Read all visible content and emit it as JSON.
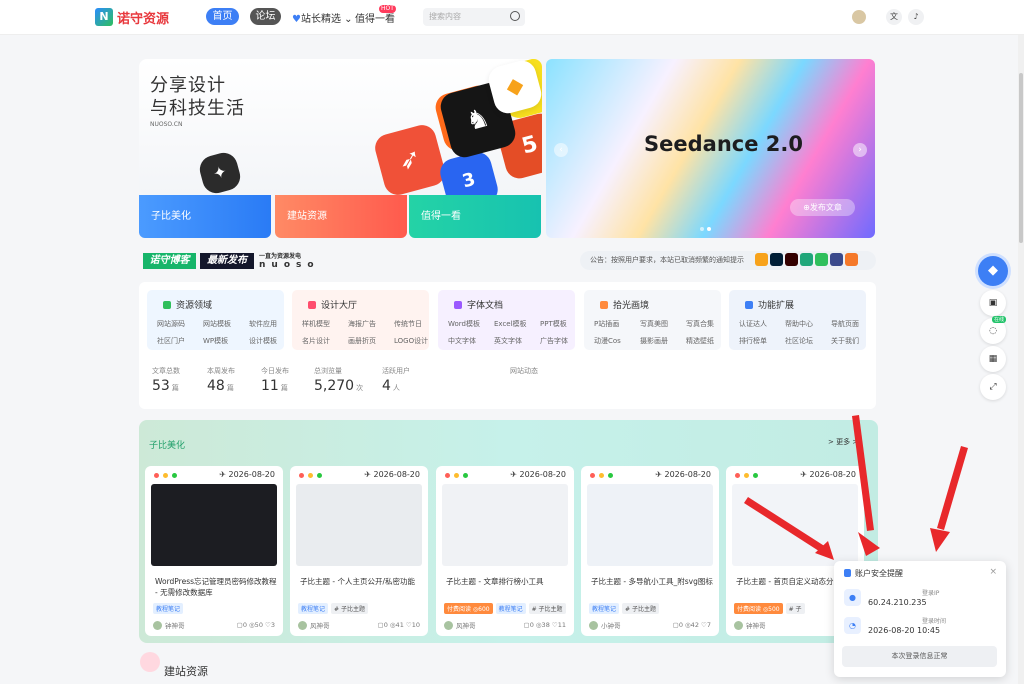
{
  "header": {
    "logo_text": "诺守资源",
    "nav": {
      "home": "首页",
      "forum": "论坛",
      "picks": "站长精选",
      "worth": "值得一看",
      "hot_badge": "HOT"
    },
    "search_placeholder": "搜索内容"
  },
  "hero": {
    "title_line1": "分享设计",
    "title_line2": "与科技生活",
    "site": "NUOSO.CN",
    "categories": [
      "子比美化",
      "建站资源",
      "值得一看"
    ],
    "slider": {
      "title": "Seedance 2.0",
      "publish_btn": "⊕发布文章"
    }
  },
  "strip": {
    "badge1": "诺守博客",
    "badge2": "最新发布",
    "slogan_top": "一直为资源发电",
    "slogan_brand": "nuoso",
    "notice": "公告：按照用户要求，本站已取消频繁的通知提示"
  },
  "directory": [
    {
      "name": "资源领域",
      "links": [
        "网站源码",
        "网站模板",
        "软件应用",
        "社区门户",
        "WP模板",
        "设计模板"
      ],
      "color": "#2fbf5c",
      "bg": "#eef6ff"
    },
    {
      "name": "设计大厅",
      "links": [
        "样机模型",
        "海报广告",
        "传统节日",
        "名片设计",
        "画册折页",
        "LOGO设计"
      ],
      "color": "#ff4d6d",
      "bg": "#fff3f0"
    },
    {
      "name": "字体文档",
      "links": [
        "Word模板",
        "Excel模板",
        "PPT模板",
        "中文字体",
        "英文字体",
        "广告字体"
      ],
      "color": "#9b59ff",
      "bg": "#f6f0ff"
    },
    {
      "name": "拾光画境",
      "links": [
        "P站插画",
        "写真美图",
        "写真合集",
        "动漫Cos",
        "摄影画册",
        "精选壁纸"
      ],
      "color": "#ff8a3d",
      "bg": "#f5f7fa"
    },
    {
      "name": "功能扩展",
      "links": [
        "认证达人",
        "帮助中心",
        "导航页面",
        "排行榜单",
        "社区论坛",
        "关于我们"
      ],
      "color": "#3d7ff5",
      "bg": "#eef3fb"
    }
  ],
  "stats": [
    {
      "label": "文章总数",
      "value": "53",
      "unit": "篇"
    },
    {
      "label": "本周发布",
      "value": "48",
      "unit": "篇"
    },
    {
      "label": "今日发布",
      "value": "11",
      "unit": "篇"
    },
    {
      "label": "总浏览量",
      "value": "5,270",
      "unit": "次"
    },
    {
      "label": "活跃用户",
      "value": "4",
      "unit": "人"
    }
  ],
  "site_activity_label": "网站动态",
  "section": {
    "title": "子比美化",
    "more": "> 更多 >",
    "cards": [
      {
        "date": "✈ 2026-08-20",
        "title": "WordPress忘记管理员密码修改教程 - 无需修改数据库",
        "tags": [
          "教程笔记"
        ],
        "paid": "",
        "author": "钟神哥",
        "meta": "▢0 ◎50 ♡3",
        "thumb": "#1c1d22"
      },
      {
        "date": "✈ 2026-08-20",
        "title": "子比主题 - 个人主页公开/私密功能",
        "tags": [
          "教程笔记",
          "# 子比主题"
        ],
        "paid": "",
        "author": "风神哥",
        "meta": "▢0 ◎41 ♡10",
        "thumb": "#e9ecef"
      },
      {
        "date": "✈ 2026-08-20",
        "title": "子比主题 - 文章排行榜小工具",
        "tags": [
          "教程笔记",
          "# 子比主题"
        ],
        "paid": "付费阅读 ◎600",
        "author": "风神哥",
        "meta": "▢0 ◎38 ♡11",
        "thumb": "#f0f2f5"
      },
      {
        "date": "✈ 2026-08-20",
        "title": "子比主题 - 多导航小工具_附svg图标",
        "tags": [
          "教程笔记",
          "# 子比主题"
        ],
        "paid": "",
        "author": "小钟哥",
        "meta": "▢0 ◎42 ♡7",
        "thumb": "#eef2f7"
      },
      {
        "date": "✈ 2026-08-20",
        "title": "子比主题 - 首页自定义动态分类标题",
        "tags": [
          "# 子"
        ],
        "paid": "付费阅读 ◎500",
        "author": "钟神哥",
        "meta": "",
        "thumb": "#f2f4f8"
      }
    ]
  },
  "next_section": "建站资源",
  "side": {
    "online": "在线"
  },
  "popup": {
    "title": "账户安全提醒",
    "ip_label": "登录IP",
    "ip": "60.24.210.235",
    "time_label": "登录时间",
    "time": "2026-08-20 10:45",
    "confirm": "本次登录信息正常"
  }
}
